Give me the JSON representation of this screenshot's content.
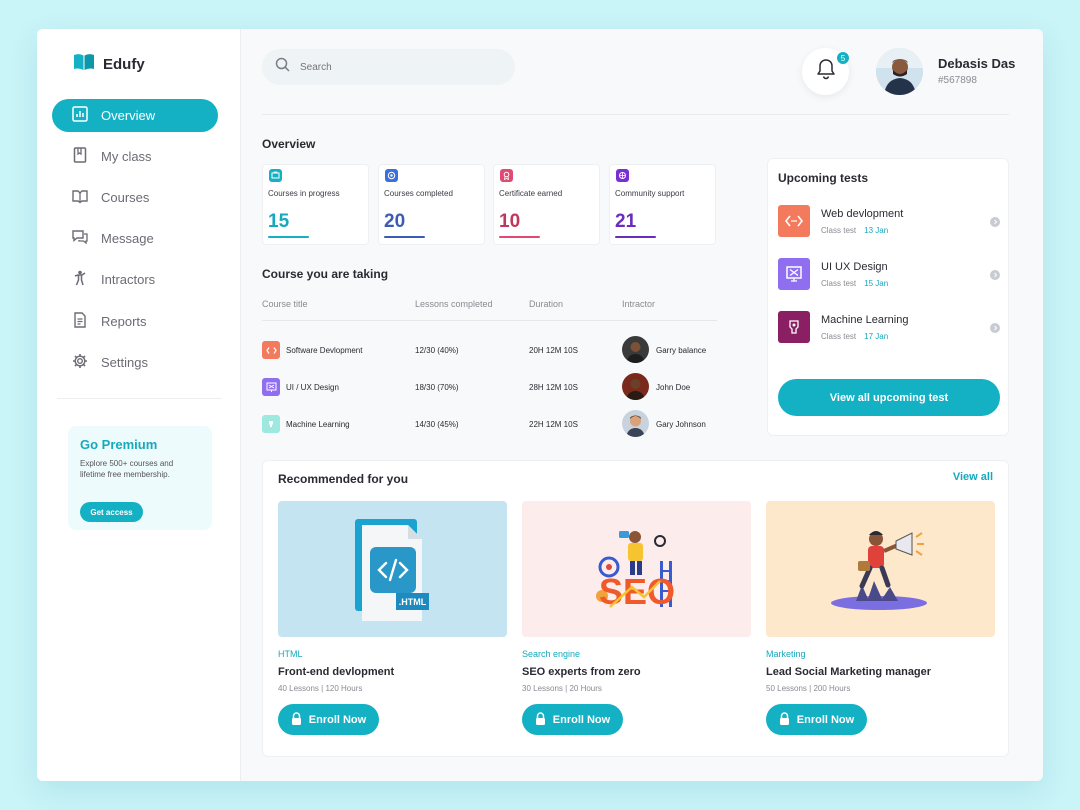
{
  "brand": {
    "name": "Edufy",
    "accent": "#14b0c4"
  },
  "sidebar": {
    "items": [
      {
        "label": "Overview",
        "icon": "chart-icon",
        "active": true
      },
      {
        "label": "My class",
        "icon": "book-icon",
        "active": false
      },
      {
        "label": "Courses",
        "icon": "open-book-icon",
        "active": false
      },
      {
        "label": "Message",
        "icon": "message-icon",
        "active": false
      },
      {
        "label": "Intractors",
        "icon": "person-icon",
        "active": false
      },
      {
        "label": "Reports",
        "icon": "document-icon",
        "active": false
      },
      {
        "label": "Settings",
        "icon": "gear-icon",
        "active": false
      }
    ],
    "premium": {
      "title": "Go Premium",
      "text": "Explore 500+ courses and lifetime free membership.",
      "button": "Get access"
    }
  },
  "header": {
    "search_placeholder": "Search",
    "notifications_count": "5",
    "user_name": "Debasis Das",
    "user_id": "#567898"
  },
  "overview": {
    "title": "Overview",
    "stats": [
      {
        "label": "Courses in progress",
        "value": "15",
        "color": "#14a9bd"
      },
      {
        "label": "Courses completed",
        "value": "20",
        "color": "#3b5bb5"
      },
      {
        "label": "Certificate earned",
        "value": "10",
        "color": "#c2375c"
      },
      {
        "label": "Community support",
        "value": "21",
        "color": "#6a2bbf"
      }
    ]
  },
  "courses": {
    "title": "Course you are taking",
    "headers": [
      "Course title",
      "Lessons completed",
      "Duration",
      "Intractor"
    ],
    "rows": [
      {
        "title": "Software Devlopment",
        "lessons": "12/30 (40%)",
        "duration": "20H 12M 10S",
        "instructor": "Garry balance"
      },
      {
        "title": "UI / UX Design",
        "lessons": "18/30 (70%)",
        "duration": "28H 12M 10S",
        "instructor": "John Doe"
      },
      {
        "title": "Machine Learning",
        "lessons": "14/30 (45%)",
        "duration": "22H 12M 10S",
        "instructor": "Gary Johnson"
      }
    ]
  },
  "upcoming": {
    "title": "Upcoming tests",
    "items": [
      {
        "name": "Web devlopment",
        "type": "Class test",
        "date": "13 Jan"
      },
      {
        "name": "UI UX Design",
        "type": "Class test",
        "date": "15 Jan"
      },
      {
        "name": "Machine Learning",
        "type": "Class test",
        "date": "17 Jan"
      }
    ],
    "button": "View all upcoming test"
  },
  "recommended": {
    "title": "Recommended for you",
    "view_all": "View all",
    "cards": [
      {
        "category": "HTML",
        "title": "Front-end devlopment",
        "lessons": "40 Lessons",
        "hours": "120 Hours",
        "button": "Enroll Now"
      },
      {
        "category": "Search engine",
        "title": "SEO experts from zero",
        "lessons": "30 Lessons",
        "hours": "20 Hours",
        "button": "Enroll Now"
      },
      {
        "category": "Marketing",
        "title": "Lead Social Marketing manager",
        "lessons": "50 Lessons",
        "hours": "200 Hours",
        "button": "Enroll Now"
      }
    ]
  }
}
